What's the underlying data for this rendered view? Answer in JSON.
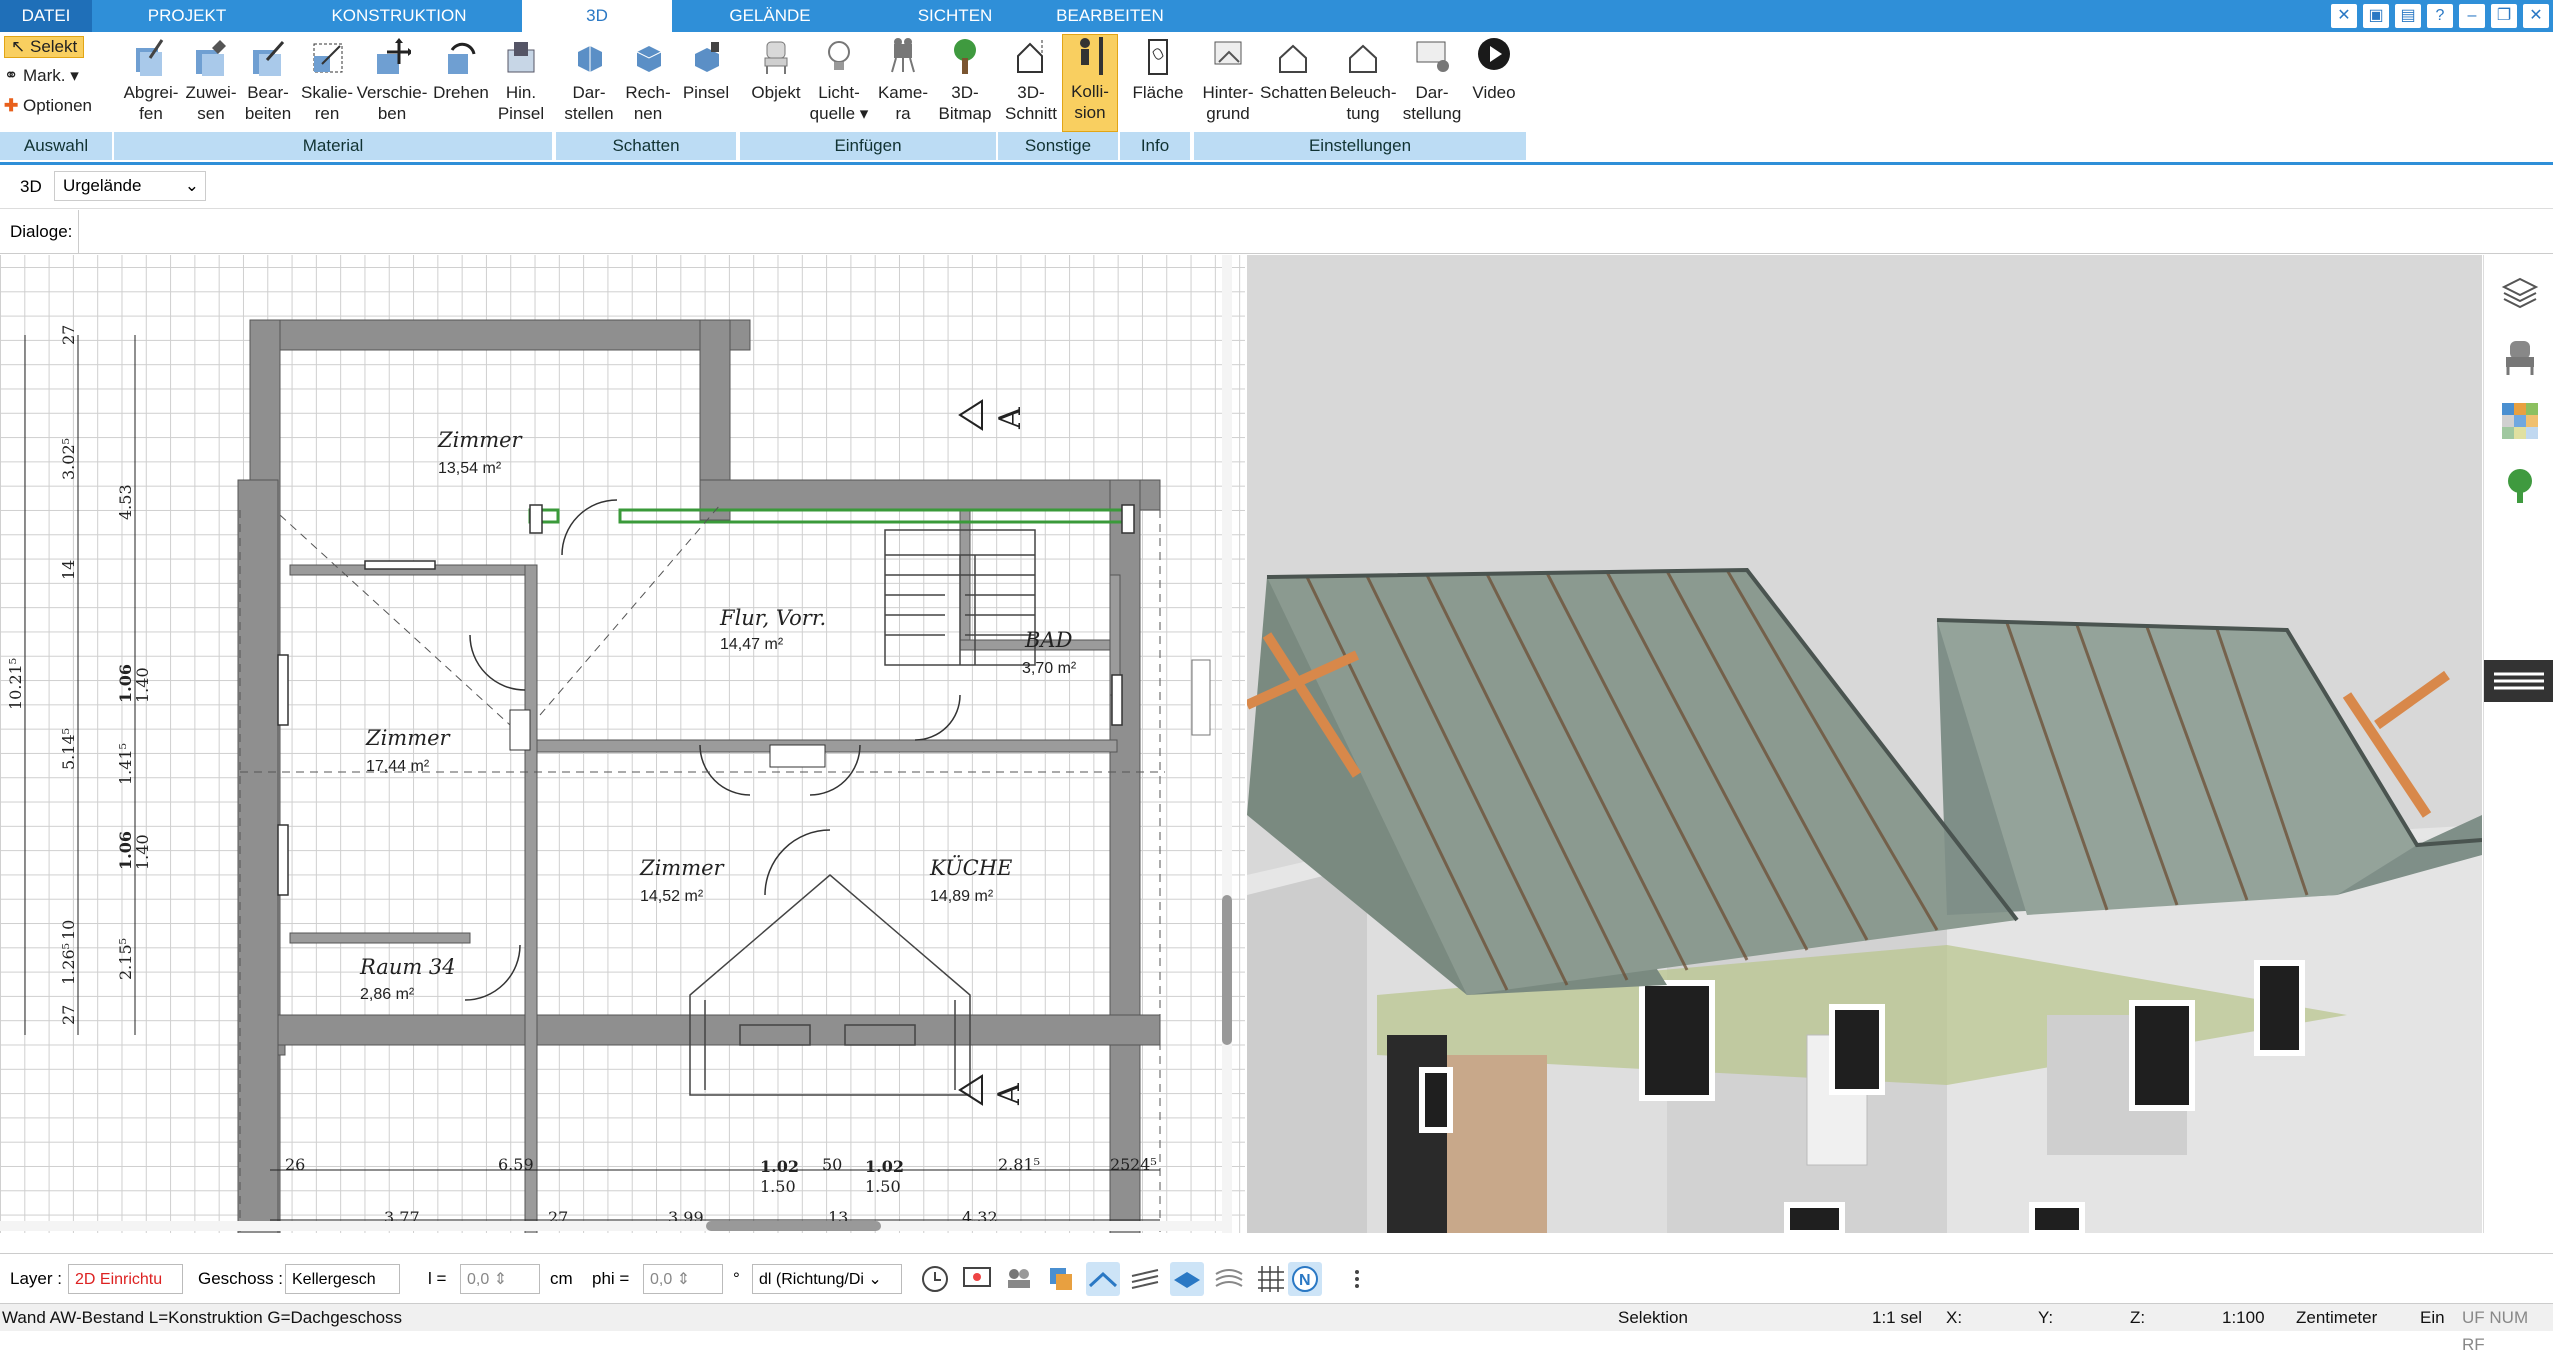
{
  "tabs": [
    "DATEI",
    "PROJEKT",
    "KONSTRUKTION",
    "3D",
    "GELÄNDE",
    "SICHTEN",
    "BEARBEITEN"
  ],
  "active_tab": "3D",
  "auswahl": {
    "selekt": "Selekt",
    "mark": "Mark.",
    "optionen": "Optionen",
    "label": "Auswahl"
  },
  "material": {
    "label": "Material",
    "buttons": [
      {
        "l1": "Abgrei-",
        "l2": "fen"
      },
      {
        "l1": "Zuwei-",
        "l2": "sen"
      },
      {
        "l1": "Bear-",
        "l2": "beiten"
      },
      {
        "l1": "Skalie-",
        "l2": "ren"
      },
      {
        "l1": "Verschie-",
        "l2": "ben"
      },
      {
        "l1": "Drehen",
        "l2": ""
      },
      {
        "l1": "Hin.",
        "l2": "Pinsel"
      }
    ]
  },
  "schatten": {
    "label": "Schatten",
    "buttons": [
      {
        "l1": "Dar-",
        "l2": "stellen"
      },
      {
        "l1": "Rech-",
        "l2": "nen"
      },
      {
        "l1": "Pinsel",
        "l2": ""
      }
    ]
  },
  "einfuegen": {
    "label": "Einfügen",
    "buttons": [
      {
        "l1": "Objekt",
        "l2": ""
      },
      {
        "l1": "Licht-",
        "l2": "quelle"
      },
      {
        "l1": "Kame-",
        "l2": "ra"
      },
      {
        "l1": "3D-",
        "l2": "Bitmap"
      }
    ]
  },
  "sonstige": {
    "label": "Sonstige",
    "buttons": [
      {
        "l1": "3D-",
        "l2": "Schnitt"
      },
      {
        "l1": "Kolli-",
        "l2": "sion"
      }
    ]
  },
  "info": {
    "label": "Info",
    "buttons": [
      {
        "l1": "Fläche",
        "l2": ""
      }
    ]
  },
  "einstellungen": {
    "label": "Einstellungen",
    "buttons": [
      {
        "l1": "Hinter-",
        "l2": "grund"
      },
      {
        "l1": "Schatten",
        "l2": ""
      },
      {
        "l1": "Beleuch-",
        "l2": "tung"
      },
      {
        "l1": "Dar-",
        "l2": "stellung"
      },
      {
        "l1": "Video",
        "l2": ""
      }
    ]
  },
  "view_bar": {
    "mode": "3D",
    "layer_select": "Urgelände"
  },
  "dialoge_label": "Dialoge:",
  "plan": {
    "rooms": [
      {
        "name": "Zimmer",
        "area": "13,54 m²"
      },
      {
        "name": "Flur, Vorr.",
        "area": "14,47 m²"
      },
      {
        "name": "BAD",
        "area": "3,70 m²"
      },
      {
        "name": "Zimmer",
        "area": "17,44 m²"
      },
      {
        "name": "Zimmer",
        "area": "14,52 m²"
      },
      {
        "name": "KÜCHE",
        "area": "14,89 m²"
      },
      {
        "name": "Raum 34",
        "area": "2,86 m²"
      }
    ],
    "section_marks": [
      "A",
      "A"
    ],
    "dims_bottom": [
      "26",
      "6.59",
      "1.02",
      "50",
      "1.02",
      "2.81⁵",
      "25",
      "24⁵",
      "1.50",
      "1.50",
      "3.77",
      "27",
      "3.99",
      "13",
      "4.32"
    ],
    "dims_left": [
      "27",
      "3.02⁵",
      "4.53",
      "14",
      "1.06",
      "1.40",
      "10.21⁵",
      "5.14⁵",
      "1.41⁵",
      "1.06",
      "1.40",
      "10",
      "1.26⁵",
      "2.15⁵",
      "27"
    ]
  },
  "status": {
    "layer_label": "Layer :",
    "layer_value": "2D Einrichtu",
    "geschoss_label": "Geschoss :",
    "geschoss_value": "Kellergesch",
    "l_label": "l =",
    "l_value": "0,0",
    "l_unit": "cm",
    "phi_label": "phi =",
    "phi_value": "0,0",
    "phi_unit": "°",
    "dl_value": "dl (Richtung/Di"
  },
  "bottom": {
    "hint": "Wand AW-Bestand L=Konstruktion G=Dachgeschoss",
    "mode": "Selektion",
    "sel": "1:1 sel",
    "x": "X:",
    "y": "Y:",
    "z": "Z:",
    "scale": "1:100",
    "unit": "Zentimeter",
    "ein": "Ein",
    "flags": "UF NUM RF"
  },
  "colors": {
    "accent": "#2f8fd8",
    "group_bg": "#bcdcf4",
    "active_toggle": "#f9cf60",
    "wall": "#8a8a8a",
    "selected_wall": "#3a9a3a"
  }
}
